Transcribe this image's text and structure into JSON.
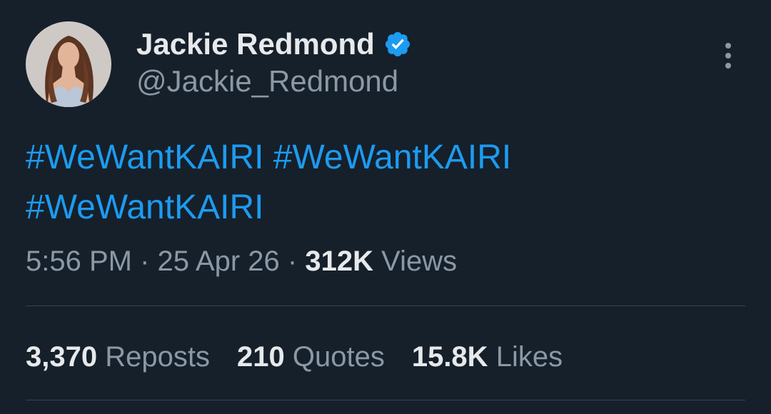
{
  "author": {
    "display_name": "Jackie Redmond",
    "handle": "@Jackie_Redmond",
    "verified_icon": "verified-badge-icon"
  },
  "tweet": {
    "hashtags": [
      "#WeWantKAIRI",
      "#WeWantKAIRI",
      "#WeWantKAIRI"
    ],
    "time": "5:56 PM",
    "separator": "·",
    "date": "25 Apr 26",
    "views_count": "312K",
    "views_label": "Views"
  },
  "stats": {
    "reposts_count": "3,370",
    "reposts_label": "Reposts",
    "quotes_count": "210",
    "quotes_label": "Quotes",
    "likes_count": "15.8K",
    "likes_label": "Likes"
  },
  "icons": {
    "more": "more-vertical-icon"
  },
  "colors": {
    "background": "#15202b",
    "accent": "#1d9bf0",
    "text_primary": "#e7e9ea",
    "text_secondary": "#8b98a5",
    "divider": "#38444d"
  }
}
